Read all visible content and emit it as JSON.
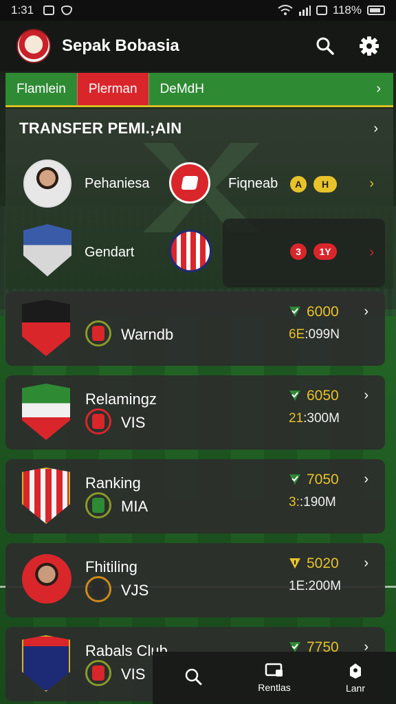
{
  "status_bar": {
    "time": "1:31",
    "battery": "118%"
  },
  "header": {
    "title": "Sepak Bobasia",
    "search_icon": "search-icon",
    "settings_icon": "gear-icon"
  },
  "tabs": [
    {
      "label": "Flamlein",
      "active": false
    },
    {
      "label": "Plerman",
      "active": true
    },
    {
      "label": "DeMdH",
      "active": false
    }
  ],
  "featured": {
    "title": "TRANSFER PEMI.;AIN",
    "rows": [
      {
        "name": "Pehaniesa",
        "destination": "Fiqneab",
        "pill_a": "A",
        "pill_b": "H"
      },
      {
        "name": "Gendart",
        "destination": "",
        "pill_a": "3",
        "pill_b": "1Y"
      }
    ]
  },
  "list": [
    {
      "name": "",
      "code": "Warndb",
      "score": "6000",
      "value_prefix": "6E",
      "value_rest": ":099N",
      "status": "green"
    },
    {
      "name": "Relamingz",
      "code": "VIS",
      "score": "6050",
      "value_prefix": "21",
      "value_rest": ":300M",
      "status": "green"
    },
    {
      "name": "Ranking",
      "code": "MIA",
      "score": "7050",
      "value_prefix": "3:",
      "value_rest": ":190M",
      "status": "green"
    },
    {
      "name": "Fhitiling",
      "code": "VJS",
      "score": "5020",
      "value_prefix": "1E",
      "value_rest": ":200M",
      "status": "yellow"
    },
    {
      "name": "Rabals Club",
      "code": "VIS",
      "score": "7750",
      "value_prefix": "",
      "value_rest": "",
      "status": "green"
    }
  ],
  "bottom_nav": [
    {
      "label": "",
      "icon": "search-icon"
    },
    {
      "label": "Rentlas",
      "icon": "monitor-icon"
    },
    {
      "label": "Lanr",
      "icon": "profile-icon"
    }
  ],
  "colors": {
    "accent_red": "#d9262b",
    "accent_green": "#2f8a34",
    "accent_yellow": "#e8c22a"
  }
}
